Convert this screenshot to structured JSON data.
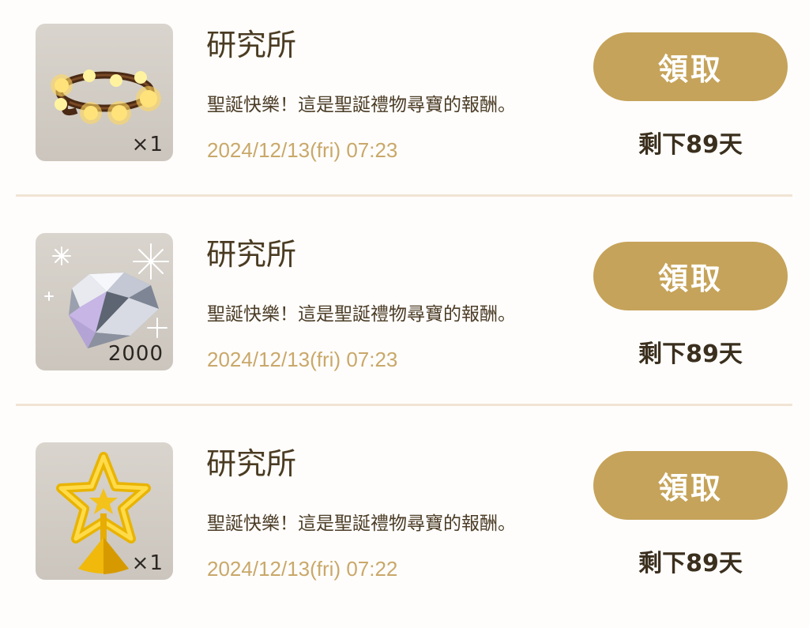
{
  "rewards": [
    {
      "title": "研究所",
      "message": "聖誕快樂！這是聖誕禮物尋寶的報酬。",
      "date": "2024/12/13(fri) 07:23",
      "quantity": "×1",
      "item_icon": "light-string-icon",
      "claim_label": "領取",
      "remaining": "剩下89天"
    },
    {
      "title": "研究所",
      "message": "聖誕快樂！這是聖誕禮物尋寶的報酬。",
      "date": "2024/12/13(fri) 07:23",
      "quantity": "2000",
      "item_icon": "diamond-icon",
      "claim_label": "領取",
      "remaining": "剩下89天"
    },
    {
      "title": "研究所",
      "message": "聖誕快樂！這是聖誕禮物尋寶的報酬。",
      "date": "2024/12/13(fri) 07:22",
      "quantity": "×1",
      "item_icon": "star-topper-icon",
      "claim_label": "領取",
      "remaining": "剩下89天"
    }
  ],
  "colors": {
    "accent": "#c5a35a",
    "date_text": "#c9a86a",
    "divider": "#f1e4d4",
    "background": "#fefdfb"
  }
}
